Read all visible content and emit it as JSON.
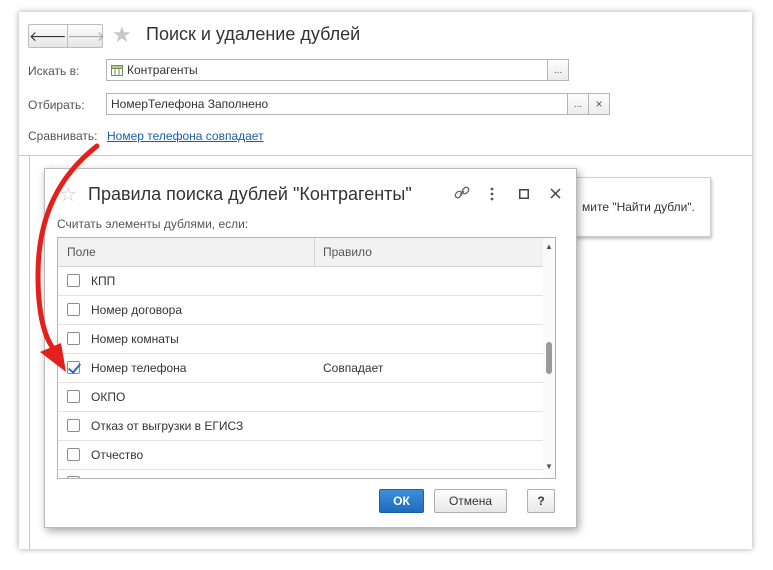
{
  "window": {
    "title": "Поиск и удаление дублей",
    "nav_back": "🡐",
    "nav_forward": "🡒",
    "search_in_label": "Искать в:",
    "search_in_value": "Контрагенты",
    "filter_label": "Отбирать:",
    "filter_value": "НомерТелефона Заполнено",
    "compare_label": "Сравнивать:",
    "compare_link": "Номер телефона совпадает",
    "hint_text": "мите \"Найти дубли\".",
    "ellipsis": "...",
    "clear": "×"
  },
  "dialog": {
    "title": "Правила поиска дублей \"Контрагенты\"",
    "subtitle": "Считать элементы дублями, если:",
    "columns": {
      "field": "Поле",
      "rule": "Правило"
    },
    "rows": [
      {
        "field": "КПП",
        "rule": "",
        "checked": false
      },
      {
        "field": "Номер договора",
        "rule": "",
        "checked": false
      },
      {
        "field": "Номер комнаты",
        "rule": "",
        "checked": false
      },
      {
        "field": "Номер телефона",
        "rule": "Совпадает",
        "checked": true
      },
      {
        "field": "ОКПО",
        "rule": "",
        "checked": false
      },
      {
        "field": "Отказ от выгрузки в ЕГИСЗ",
        "rule": "",
        "checked": false
      },
      {
        "field": "Отчество",
        "rule": "",
        "checked": false
      }
    ],
    "buttons": {
      "ok": "ОК",
      "cancel": "Отмена",
      "help": "?"
    }
  },
  "colors": {
    "arrow": "#e5201b",
    "link": "#1a5fa8",
    "ok_button": "#2a77c9",
    "checkmark": "#2b6cc0"
  },
  "icons": [
    "star-icon",
    "back-arrow-icon",
    "forward-arrow-icon",
    "table-icon",
    "link-icon",
    "more-vertical-icon",
    "maximize-icon",
    "close-icon",
    "checkbox-icon"
  ]
}
